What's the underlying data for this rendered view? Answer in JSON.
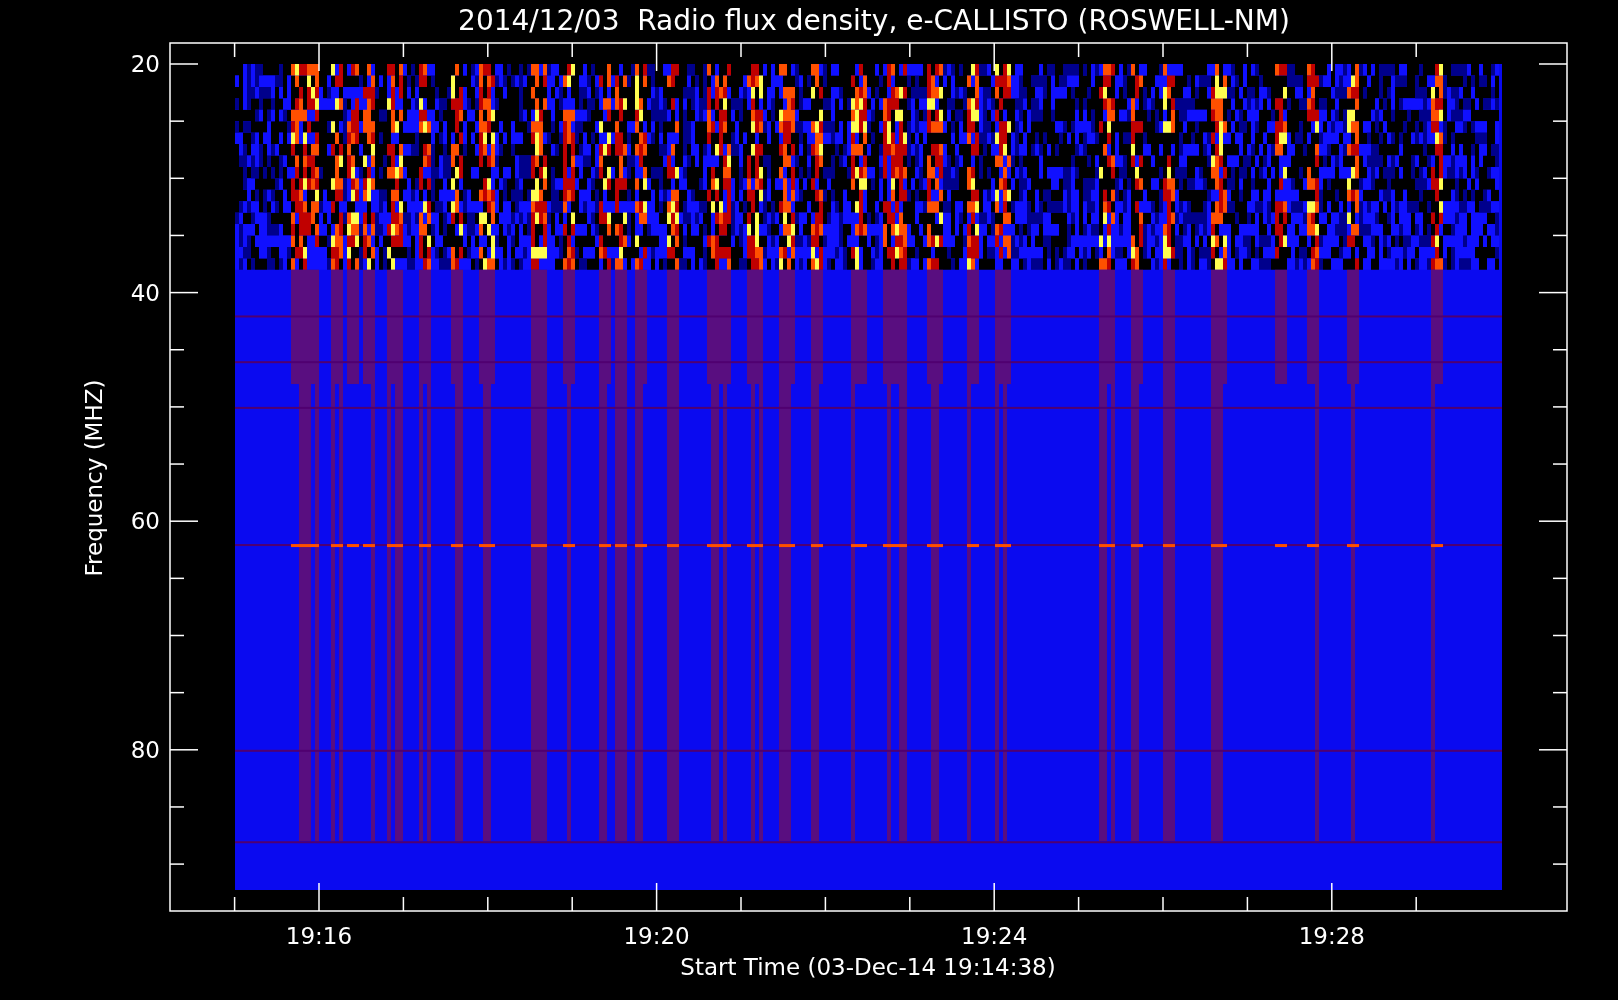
{
  "title": "2014/12/03  Radio flux density, e-CALLISTO (ROSWELL-NM)",
  "x_axis": {
    "label": "Start Time (03-Dec-14 19:14:38)",
    "ticks": [
      "19:16",
      "19:20",
      "19:24",
      "19:28"
    ]
  },
  "y_axis": {
    "label": "Frequency (MHZ)",
    "ticks": [
      "20",
      "40",
      "60",
      "80"
    ]
  }
}
